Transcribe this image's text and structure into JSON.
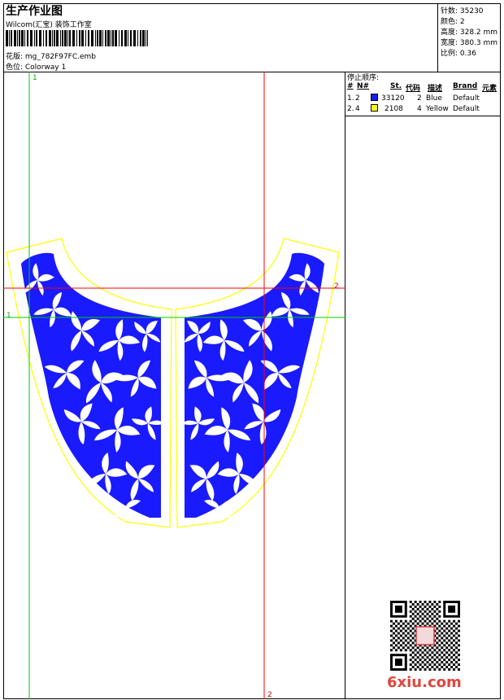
{
  "header": {
    "title": "生产作业图",
    "studio": "Wilcom(汇宝) 装饰工作室",
    "design_line": "花版:  mg_782F97FC.emb",
    "color_line": "色位:  Colorway 1"
  },
  "stats": [
    "针数: 35230",
    "颜色: 2",
    "高度: 328.2 mm",
    "宽度: 380.3 mm",
    "比例: 0.36"
  ],
  "stop_panel": {
    "title": "停止顺序:",
    "headers": [
      "#",
      "N#",
      "St.",
      "代码",
      "描述",
      "Brand",
      "元素"
    ],
    "rows": [
      {
        "seq": "1.",
        "n": "2",
        "stitches": "33120",
        "code": "2",
        "desc": "Blue",
        "brand": "Default",
        "color": "#1a1aff"
      },
      {
        "seq": "2.",
        "n": "4",
        "stitches": "2108",
        "code": "4",
        "desc": "Yellow",
        "brand": "Default",
        "color": "#ffff00"
      }
    ]
  },
  "guides": {
    "green_top": "1",
    "green_left": "1",
    "red_right": "2",
    "red_bottom": "2"
  },
  "colors": {
    "blue": "#1a1aff",
    "yellow": "#ffff00",
    "red": "#ff0000",
    "green": "#00cc00"
  },
  "watermark": "6xiu.com"
}
